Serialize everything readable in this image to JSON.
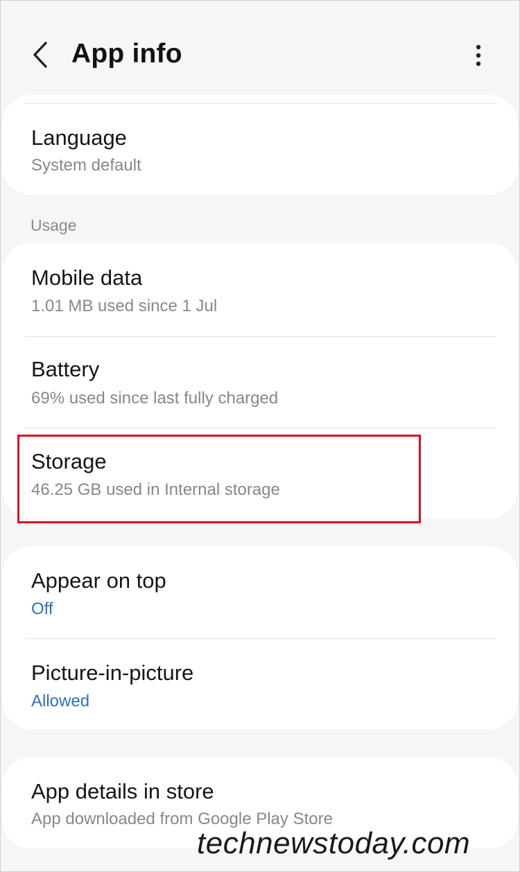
{
  "header": {
    "title": "App info"
  },
  "card1": {
    "language": {
      "title": "Language",
      "subtitle": "System default"
    }
  },
  "usage_section": {
    "label": "Usage",
    "mobile_data": {
      "title": "Mobile data",
      "subtitle": "1.01 MB used since 1 Jul"
    },
    "battery": {
      "title": "Battery",
      "subtitle": "69% used since last fully charged"
    },
    "storage": {
      "title": "Storage",
      "subtitle": "46.25 GB used in Internal storage"
    }
  },
  "permissions": {
    "appear_on_top": {
      "title": "Appear on top",
      "subtitle": "Off"
    },
    "picture_in_picture": {
      "title": "Picture-in-picture",
      "subtitle": "Allowed"
    }
  },
  "store": {
    "app_details": {
      "title": "App details in store",
      "subtitle": "App downloaded from Google Play Store"
    }
  },
  "watermark": "technewstoday.com",
  "colors": {
    "highlight": "#d7121f",
    "link": "#2d6fc0",
    "background": "#f6f6f6"
  },
  "icons": {
    "back": "chevron-left-icon",
    "more": "more-vertical-icon"
  }
}
